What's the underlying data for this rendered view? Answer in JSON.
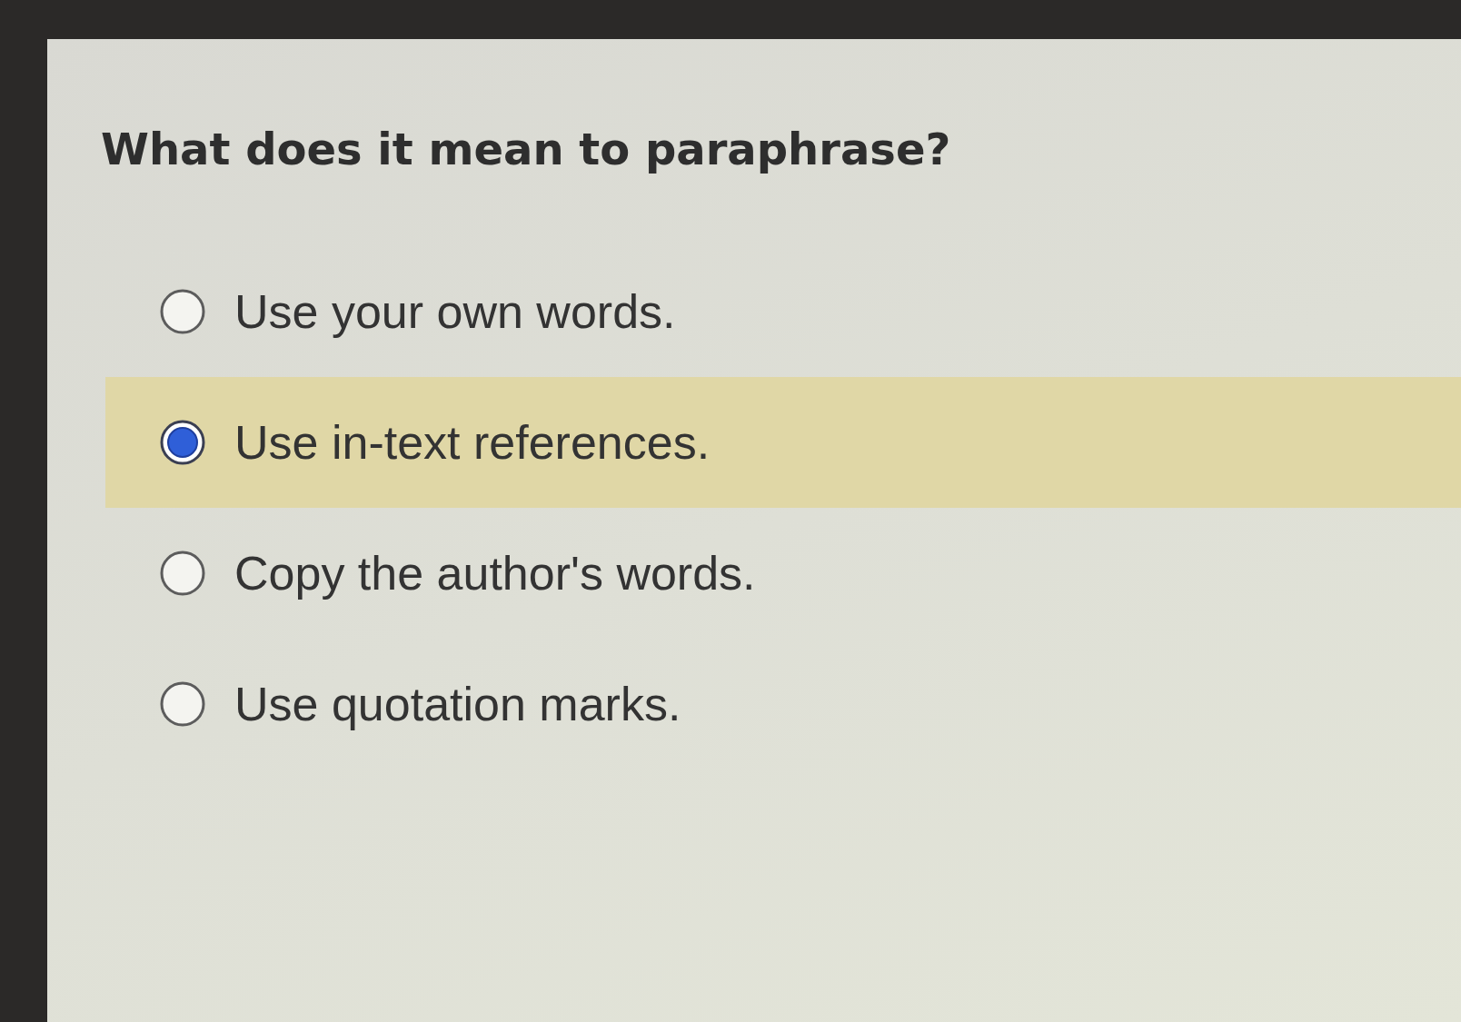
{
  "question": {
    "text": "What does it mean to paraphrase?"
  },
  "options": [
    {
      "label": "Use your own words.",
      "selected": false
    },
    {
      "label": "Use in-text references.",
      "selected": true
    },
    {
      "label": "Copy the author's words.",
      "selected": false
    },
    {
      "label": "Use quotation marks.",
      "selected": false
    }
  ]
}
